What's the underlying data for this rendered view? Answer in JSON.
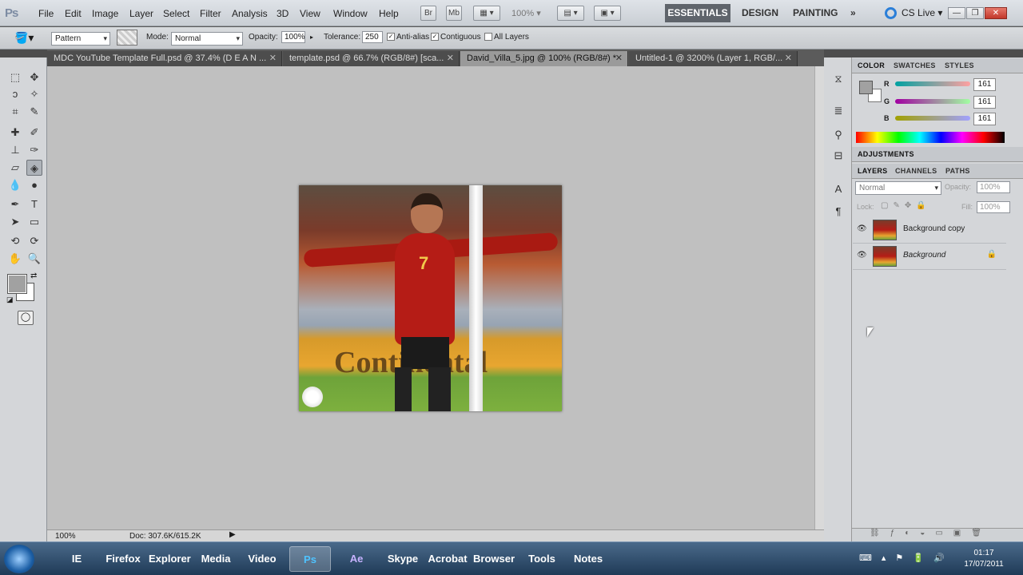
{
  "menubar": {
    "logo": "Ps",
    "menus": [
      "File",
      "Edit",
      "Image",
      "Layer",
      "Select",
      "Filter",
      "Analysis",
      "3D",
      "View",
      "Window",
      "Help"
    ],
    "bridge_label": "Br",
    "minibridge_label": "Mb",
    "zoom": "100%",
    "workspaces": {
      "essentials": "ESSENTIALS",
      "design": "DESIGN",
      "painting": "PAINTING",
      "more": "»"
    },
    "cslive": "CS Live"
  },
  "options": {
    "fill_source": "Pattern",
    "mode_label": "Mode:",
    "mode": "Normal",
    "opacity_label": "Opacity:",
    "opacity": "100%",
    "tolerance_label": "Tolerance:",
    "tolerance": "250",
    "antialias": "Anti-alias",
    "contiguous": "Contiguous",
    "all_layers": "All Layers"
  },
  "tabs": [
    {
      "label": "MDC YouTube Template Full.psd @ 37.4% (D E A N ..."
    },
    {
      "label": "template.psd @ 66.7% (RGB/8#) [sca..."
    },
    {
      "label": "David_Villa_5.jpg @ 100% (RGB/8#) *"
    },
    {
      "label": "Untitled-1 @ 3200% (Layer 1, RGB/..."
    }
  ],
  "document": {
    "banner_text": "Continental",
    "jersey_number": "7"
  },
  "status": {
    "zoom": "100%",
    "doc": "Doc: 307.6K/615.2K"
  },
  "color_panel": {
    "tabs": [
      "COLOR",
      "SWATCHES",
      "STYLES"
    ],
    "r_label": "R",
    "g_label": "G",
    "b_label": "B",
    "r": "161",
    "g": "161",
    "b": "161",
    "foreground": "#a1a1a1"
  },
  "adjustments": {
    "title": "ADJUSTMENTS"
  },
  "layers_panel": {
    "tabs": [
      "LAYERS",
      "CHANNELS",
      "PATHS"
    ],
    "blend": "Normal",
    "opacity_label": "Opacity:",
    "opacity": "100%",
    "lock_label": "Lock:",
    "fill_label": "Fill:",
    "fill": "100%",
    "layers": [
      {
        "name": "Background copy"
      },
      {
        "name": "Background"
      }
    ]
  },
  "taskbar": {
    "apps": [
      "IE",
      "Firefox",
      "Explorer",
      "Media",
      "Video",
      "Ps",
      "Ae",
      "Skype",
      "Acrobat",
      "Browser",
      "Tools",
      "Notes"
    ],
    "time": "01:17",
    "date": "17/07/2011"
  }
}
